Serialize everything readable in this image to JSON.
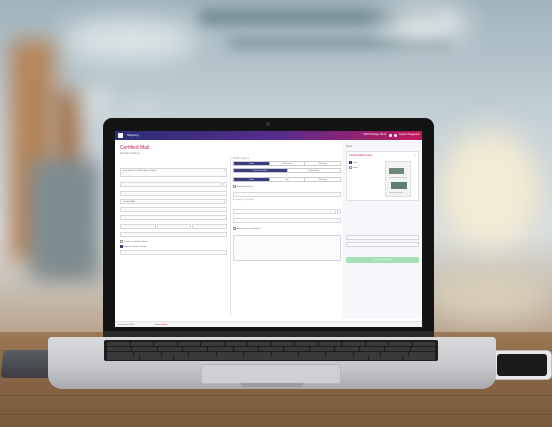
{
  "scene": {
    "description_colors": {
      "appbar_start": "#2b2d7a",
      "appbar_end": "#c2185b",
      "accent": "#c2185b",
      "button_green": "#a8dfb4",
      "segment_on": "#3a3d7e"
    }
  },
  "app": {
    "appbar": {
      "title": "Shipping",
      "right_items": [
        "USPS Postage: $0.00",
        "Support Suggestion"
      ]
    },
    "page": {
      "title": "Certified Mail",
      "subtitle": "Recipient Address"
    },
    "left_column": {
      "fields": [
        {
          "label": "",
          "value": "Jane Doe LLC, 1 Main Street, Suite 1"
        },
        {
          "label": "",
          "value": ""
        },
        {
          "label": "",
          "value": "Certified Mail"
        },
        {
          "label": "",
          "value": ""
        },
        {
          "label": "",
          "value": ""
        }
      ],
      "checkboxes": [
        {
          "label": "This is a residential address",
          "checked": false
        },
        {
          "label": "Electronic Return Receipt",
          "checked": true
        }
      ]
    },
    "middle_column": {
      "heading": "Mailing Options",
      "segments_1": [
        "Letter",
        "Flat/Large",
        "Package"
      ],
      "segments_2": [
        "First Class Mail",
        "Priority Mail"
      ],
      "segments_3": [
        "Letter",
        "Flat",
        "Package"
      ],
      "checkboxes": [
        {
          "label": "Restricted delivery",
          "checked": false
        },
        {
          "label": "Also email the confirmation",
          "checked": false
        }
      ],
      "fields": [
        {
          "label": "Weight",
          "value": ""
        },
        {
          "label": "Accounting / Reference",
          "value": ""
        },
        {
          "label": "Client matter",
          "value": ""
        },
        {
          "label": "Custom reference",
          "value": ""
        },
        {
          "label": "Notes",
          "value": ""
        }
      ]
    },
    "right_panel": {
      "title": "Steps",
      "card_heading": "Certified Mail Preview",
      "card_close": "×",
      "radio_options": [
        "Letter",
        "Label"
      ],
      "fields": [
        {
          "label": "",
          "value": ""
        },
        {
          "label": "",
          "value": ""
        }
      ],
      "button_label": "Create Certified Mail"
    },
    "footer": {
      "text": "Powered by USPS",
      "link": "Privacy Policy"
    }
  }
}
